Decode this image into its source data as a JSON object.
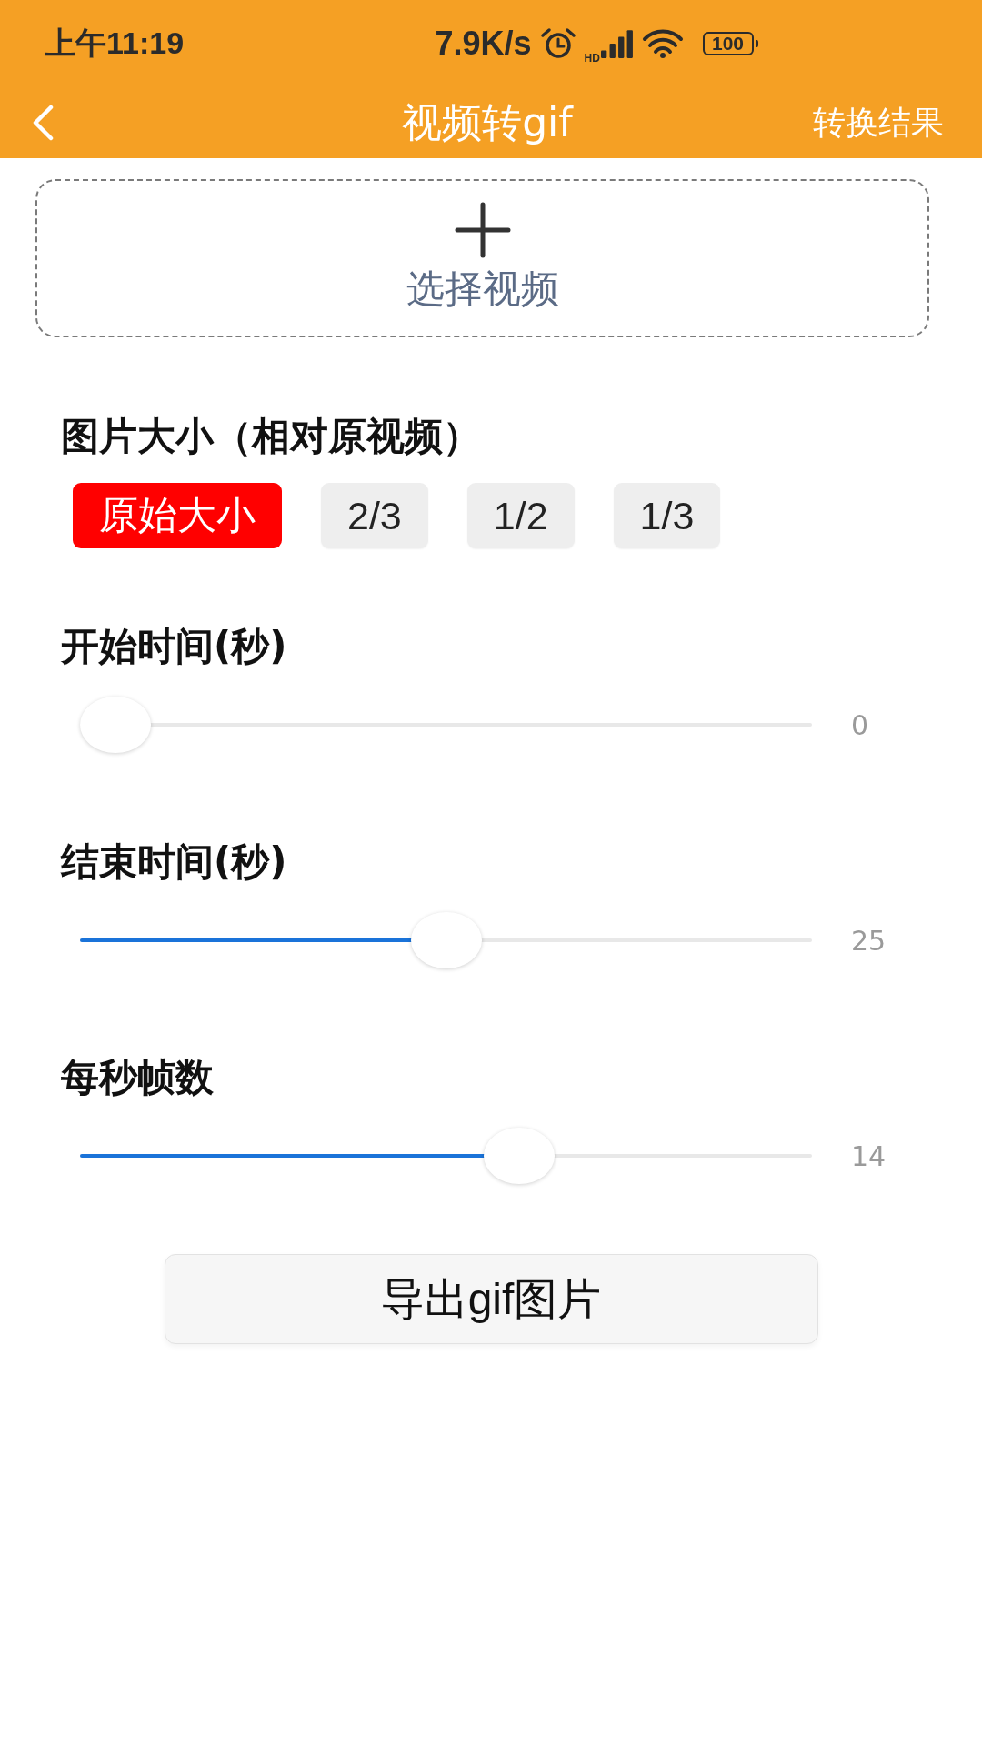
{
  "status_bar": {
    "time": "上午11:19",
    "network_speed": "7.9K/s",
    "signal_label": "HD",
    "battery": "100"
  },
  "header": {
    "title": "视频转gif",
    "action": "转换结果"
  },
  "video_picker": {
    "label": "选择视频"
  },
  "image_size": {
    "title": "图片大小（相对原视频）",
    "options": [
      {
        "label": "原始大小",
        "selected": true
      },
      {
        "label": "2/3",
        "selected": false
      },
      {
        "label": "1/2",
        "selected": false
      },
      {
        "label": "1/3",
        "selected": false
      }
    ]
  },
  "sliders": [
    {
      "label": "开始时间(秒)",
      "level": 0,
      "reading": "0"
    },
    {
      "label": "结束时间(秒)",
      "level": 0.5,
      "reading": "25"
    },
    {
      "label": "每秒帧数",
      "level": 0.6,
      "reading": "14"
    }
  ],
  "export_button": {
    "label": "导出gif图片"
  }
}
